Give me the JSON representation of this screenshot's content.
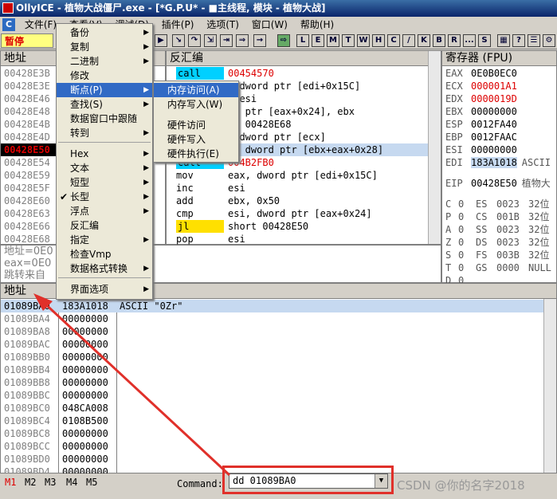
{
  "title": "OllyICE - 植物大战僵尸.exe - [*G.P.U* - ■主线程, 模块 - 植物大战]",
  "menubar": {
    "c_icon": "C",
    "items": [
      "文件(F)",
      "查看(V)",
      "调试(D)",
      "插件(P)",
      "选项(T)",
      "窗口(W)",
      "帮助(H)"
    ]
  },
  "toolbar": {
    "pause": "暂停",
    "letters": [
      "L",
      "E",
      "M",
      "T",
      "W",
      "H",
      "C",
      "/",
      "K",
      "B",
      "R",
      "...",
      "S"
    ]
  },
  "cpu": {
    "addr_header": "地址",
    "disasm_header": "反汇编",
    "addresses": [
      "00428E3B",
      "00428E3E",
      "00428E46",
      "00428E48",
      "00428E4B",
      "00428E4D",
      "00428E50",
      "00428E54",
      "00428E59",
      "00428E5F",
      "00428E60",
      "00428E63",
      "00428E66",
      "00428E68"
    ],
    "current_address": "00428E50",
    "disasm": [
      {
        "op": "call",
        "args": "00454570"
      },
      {
        "op": "",
        "args": ", dword ptr [edi+0x15C]"
      },
      {
        "op": "",
        "args": ", esi"
      },
      {
        "op": "",
        "args": "rd ptr [eax+0x24], ebx"
      },
      {
        "op": "",
        "args": "rt 00428E68"
      },
      {
        "op": "",
        "args": ", dword ptr [ecx]"
      },
      {
        "op": "",
        "args": "x, dword ptr [ebx+eax+0x28]"
      },
      {
        "op": "call",
        "args": "004B2FB0"
      },
      {
        "op": "mov",
        "args": "eax, dword ptr [edi+0x15C]"
      },
      {
        "op": "inc",
        "args": "esi"
      },
      {
        "op": "add",
        "args": "ebx, 0x50"
      },
      {
        "op": "cmp",
        "args": "esi, dword ptr [eax+0x24]"
      },
      {
        "op": "jl",
        "args": "short 00428E50"
      },
      {
        "op": "pop",
        "args": "esi"
      }
    ],
    "info_lines": [
      "地址=0E0",
      "eax=0E0",
      "跳转来自"
    ]
  },
  "registers": {
    "header": "寄存器 (FPU)",
    "regs": [
      {
        "name": "EAX",
        "value": "0E0B0EC0",
        "changed": false
      },
      {
        "name": "ECX",
        "value": "000001A1",
        "changed": true
      },
      {
        "name": "EDX",
        "value": "0000019D",
        "changed": true
      },
      {
        "name": "EBX",
        "value": "00000000",
        "changed": false
      },
      {
        "name": "ESP",
        "value": "0012FA40",
        "changed": false
      },
      {
        "name": "EBP",
        "value": "0012FAAC",
        "changed": false
      },
      {
        "name": "ESI",
        "value": "00000000",
        "changed": false
      },
      {
        "name": "EDI",
        "value": "183A1018",
        "changed": false,
        "note": "ASCII"
      }
    ],
    "eip": {
      "name": "EIP",
      "value": "00428E50",
      "note": "植物大"
    },
    "flags": [
      {
        "f": "C",
        "v": "0",
        "seg": "ES",
        "sv": "0023",
        "bits": "32位"
      },
      {
        "f": "P",
        "v": "0",
        "seg": "CS",
        "sv": "001B",
        "bits": "32位"
      },
      {
        "f": "A",
        "v": "0",
        "seg": "SS",
        "sv": "0023",
        "bits": "32位"
      },
      {
        "f": "Z",
        "v": "0",
        "seg": "DS",
        "sv": "0023",
        "bits": "32位"
      },
      {
        "f": "S",
        "v": "0",
        "seg": "FS",
        "sv": "003B",
        "bits": "32位"
      },
      {
        "f": "T",
        "v": "0",
        "seg": "GS",
        "sv": "0000",
        "bits": "NULL"
      },
      {
        "f": "D",
        "v": "0",
        "seg": "",
        "sv": "",
        "bits": ""
      }
    ]
  },
  "dump": {
    "header": "地址",
    "rows": [
      {
        "addr": "01089BA0",
        "val": "183A1018",
        "comment": "ASCII \"0Zr\""
      },
      {
        "addr": "01089BA4",
        "val": "00000000",
        "comment": ""
      },
      {
        "addr": "01089BA8",
        "val": "00000000",
        "comment": ""
      },
      {
        "addr": "01089BAC",
        "val": "00000000",
        "comment": ""
      },
      {
        "addr": "01089BB0",
        "val": "00000000",
        "comment": ""
      },
      {
        "addr": "01089BB4",
        "val": "00000000",
        "comment": ""
      },
      {
        "addr": "01089BB8",
        "val": "00000000",
        "comment": ""
      },
      {
        "addr": "01089BBC",
        "val": "00000000",
        "comment": ""
      },
      {
        "addr": "01089BC0",
        "val": "048CA008",
        "comment": ""
      },
      {
        "addr": "01089BC4",
        "val": "0108B500",
        "comment": ""
      },
      {
        "addr": "01089BC8",
        "val": "00000000",
        "comment": ""
      },
      {
        "addr": "01089BCC",
        "val": "00000000",
        "comment": ""
      },
      {
        "addr": "01089BD0",
        "val": "00000000",
        "comment": ""
      },
      {
        "addr": "01089BD4",
        "val": "00000000",
        "comment": ""
      }
    ]
  },
  "context_menu": {
    "items": [
      {
        "label": "备份",
        "sub": true,
        "check": false
      },
      {
        "label": "复制",
        "sub": true,
        "check": false
      },
      {
        "label": "二进制",
        "sub": true,
        "check": false
      },
      {
        "label": "修改",
        "sub": false,
        "check": false
      },
      {
        "label": "断点(P)",
        "sub": true,
        "check": false,
        "highlight": true
      },
      {
        "label": "查找(S)",
        "sub": true,
        "check": false
      },
      {
        "label": "数据窗口中跟随",
        "sub": false,
        "check": false
      },
      {
        "label": "转到",
        "sub": true,
        "check": false
      },
      {
        "label": "Hex",
        "sub": true,
        "check": false
      },
      {
        "label": "文本",
        "sub": true,
        "check": false
      },
      {
        "label": "短型",
        "sub": true,
        "check": false
      },
      {
        "label": "长型",
        "sub": true,
        "check": true
      },
      {
        "label": "浮点",
        "sub": true,
        "check": false
      },
      {
        "label": "反汇编",
        "sub": false,
        "check": false
      },
      {
        "label": "指定",
        "sub": true,
        "check": false
      },
      {
        "label": "检查Vmp",
        "sub": false,
        "check": false
      },
      {
        "label": "数据格式转换",
        "sub": true,
        "check": false
      },
      {
        "label": "界面选项",
        "sub": true,
        "check": false
      }
    ],
    "submenu": [
      "内存访问(A)",
      "内存写入(W)",
      "硬件访问",
      "硬件写入",
      "硬件执行(E)"
    ]
  },
  "statusbar": {
    "tabs": [
      "M1",
      "M2",
      "M3",
      "M4",
      "M5"
    ],
    "command_label": "Command:",
    "command_value": "dd 01089BA0"
  },
  "watermark": "CSDN @你的名字2018",
  "colors": {
    "menu_highlight": "#316ac5",
    "annotation_red": "#e0302a",
    "selection": "#c6d9f0"
  }
}
